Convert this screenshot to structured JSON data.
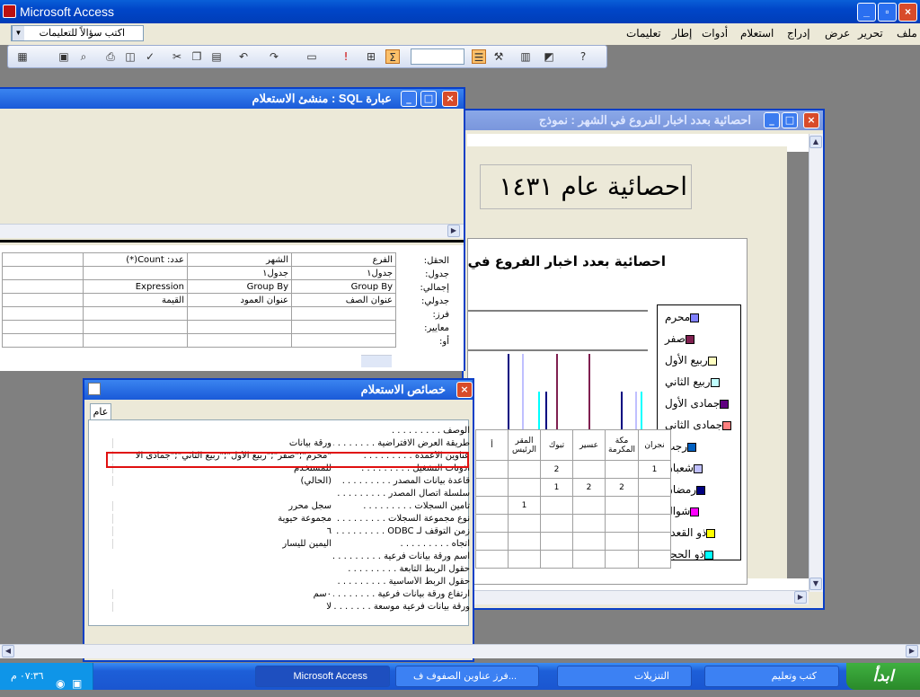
{
  "app": {
    "title": "Microsoft Access"
  },
  "menu": {
    "items": [
      "ملف",
      "تحرير",
      "عرض",
      "إدراج",
      "استعلام",
      "أدوات",
      "إطار",
      "تعليمات"
    ],
    "question_placeholder": "اكتب سؤالاً للتعليمات"
  },
  "sql_window": {
    "title": "عبارة SQL : منشئ الاستعلام",
    "row_labels": [
      "الحقل:",
      "جدول:",
      "إجمالي:",
      "جدولي:",
      "فرز:",
      "معايير:",
      "أو:"
    ],
    "columns": [
      [
        "الفرع",
        "جدول١",
        "Group By",
        "عنوان الصف",
        "",
        "",
        ""
      ],
      [
        "الشهر",
        "جدول١",
        "Group By",
        "عنوان العمود",
        "",
        "",
        ""
      ],
      [
        "عدد: Count(*)",
        "",
        "Expression",
        "القيمة",
        "",
        "",
        ""
      ],
      [
        "",
        "",
        "",
        "",
        "",
        "",
        ""
      ]
    ]
  },
  "form_window": {
    "title": "احصائية بعدد اخبار الفروع في الشهر : نموذج",
    "header_title": "احصائية عام ١٤٣١"
  },
  "chart_data": {
    "type": "bar",
    "title": "احصائية بعدد اخبار الفروع في",
    "legend": [
      "محرم",
      "صفر",
      "ربيع الأول",
      "ربيع الثاني",
      "جمادى الأول",
      "جمادى الثاني",
      "رجب",
      "شعبان",
      "رمضان",
      "شوال",
      "ذو القعدة",
      "ذو الحجة"
    ],
    "legend_colors": [
      "#8080ff",
      "#802050",
      "#ffffc0",
      "#c0ffff",
      "#600080",
      "#ff8080",
      "#0060c0",
      "#c0c0ff",
      "#000080",
      "#ff00ff",
      "#ffff00",
      "#00ffff"
    ],
    "categories": [
      "نجران",
      "مكة المكرمة",
      "عسير",
      "تبوك",
      "المقر الرئيس",
      "أ"
    ],
    "table_rows": [
      [
        "1",
        "",
        "",
        "2",
        ""
      ],
      [
        "",
        "2",
        "2",
        "1",
        ""
      ],
      [
        "",
        "",
        "",
        "",
        "1"
      ],
      [
        "",
        "",
        "",
        "",
        ""
      ],
      [
        "",
        "",
        "",
        "",
        ""
      ],
      [
        "",
        "",
        "",
        "",
        ""
      ]
    ]
  },
  "props_window": {
    "title": "خصائص الاستعلام",
    "tab": "عام",
    "rows": [
      [
        "الوصف",
        ""
      ],
      [
        "طريقة العرض الافتراضية",
        "ورقة بيانات"
      ],
      [
        "عناوين الأعمدة",
        "\"محرم\";\"صفر\";\"ربيع الأول\";\"ربيع الثاني\";\"جمادى الا"
      ],
      [
        "أذونات التشغيل",
        "للمستخدم"
      ],
      [
        "قاعدة بيانات المصدر",
        "(الحالي)"
      ],
      [
        "سلسلة اتصال المصدر",
        ""
      ],
      [
        "تأمين السجلات",
        "سجل محرر"
      ],
      [
        "نوع مجموعة السجلات",
        "مجموعة حيوية"
      ],
      [
        "زمن التوقف لـ ODBC",
        "٦"
      ],
      [
        "اتجاه",
        "اليمين لليسار"
      ],
      [
        "اسم ورقة بيانات فرعية",
        ""
      ],
      [
        "حقول الربط التابعة",
        ""
      ],
      [
        "حقول الربط الأساسية",
        ""
      ],
      [
        "ارتفاع ورقة بيانات فرعية",
        "٠سم"
      ],
      [
        "ورقة بيانات فرعية موسعة",
        "لا"
      ]
    ]
  },
  "taskbar": {
    "start": "ابدأ",
    "clock": "٠٧:٣٦ م",
    "tasks": [
      "كتب وتعليم",
      "التنزيلات",
      "فرز عناوين الصفوف ف...",
      "Microsoft Access"
    ]
  }
}
